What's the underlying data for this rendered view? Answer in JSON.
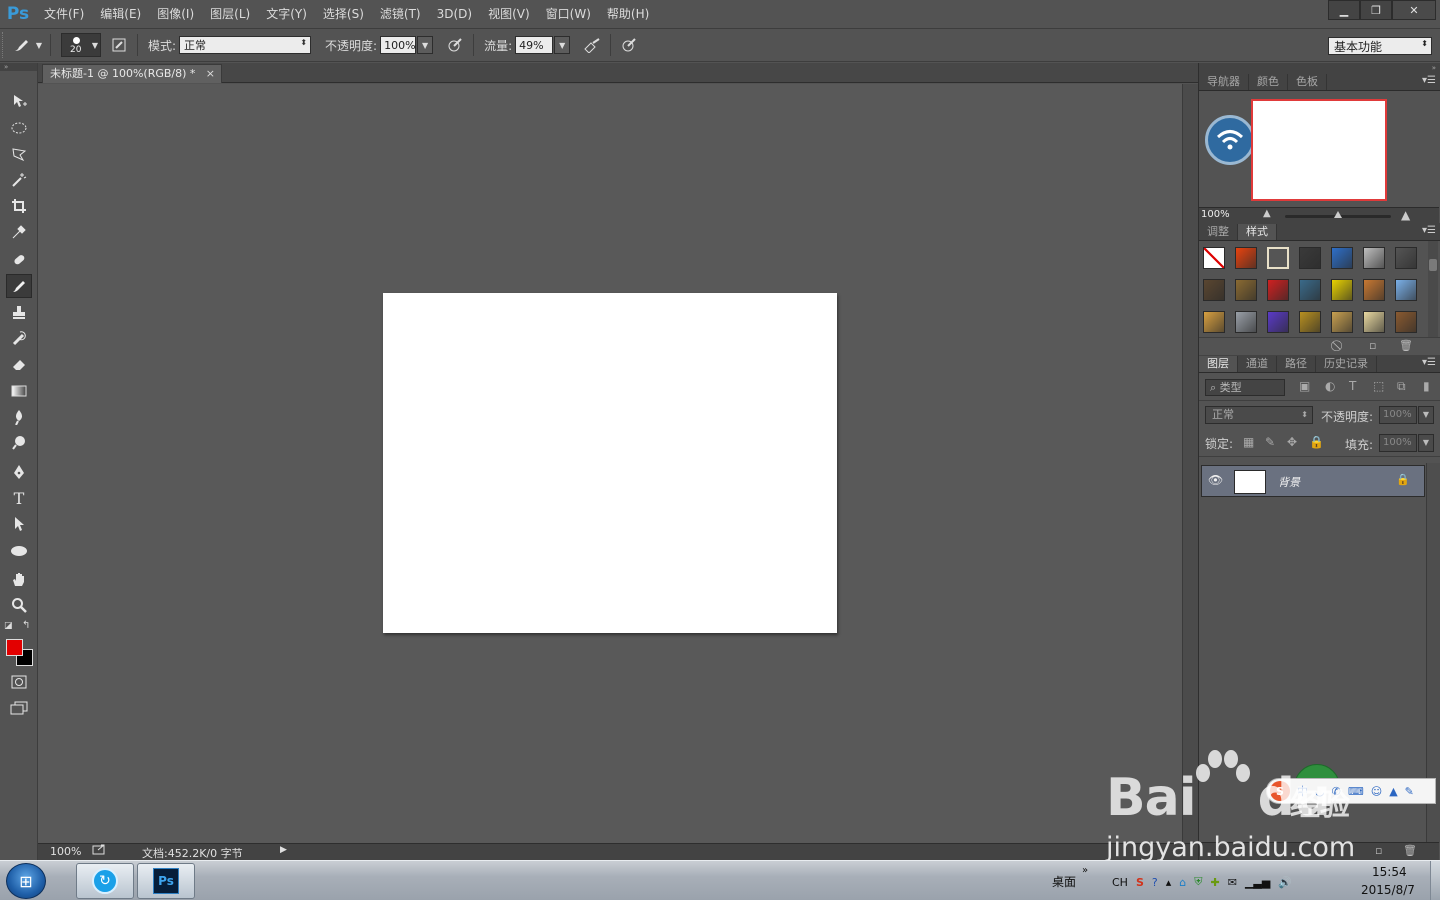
{
  "app": {
    "logo": "Ps",
    "menu": [
      "文件(F)",
      "编辑(E)",
      "图像(I)",
      "图层(L)",
      "文字(Y)",
      "选择(S)",
      "滤镜(T)",
      "3D(D)",
      "视图(V)",
      "窗口(W)",
      "帮助(H)"
    ],
    "window_controls": {
      "minimize": "▁",
      "restore": "❐",
      "close": "✕"
    }
  },
  "options": {
    "brush_size": "20",
    "mode_label": "模式:",
    "mode_value": "正常",
    "opacity_label": "不透明度:",
    "opacity_value": "100%",
    "flow_label": "流量:",
    "flow_value": "49%",
    "workspace": "基本功能"
  },
  "document": {
    "tab_title": "未标题-1 @ 100%(RGB/8) *",
    "tab_close": "×",
    "status_zoom": "100%",
    "status_info": "文档:452.2K/0 字节"
  },
  "panels": {
    "nav_tabs": [
      "导航器",
      "颜色",
      "色板"
    ],
    "nav_active": 0,
    "nav_zoom": "100%",
    "style_tabs": [
      "调整",
      "样式"
    ],
    "style_active": 1,
    "style_swatches": [
      "#e8e8e8",
      "#e8430f",
      "#d8d2c0",
      "#3a3a3a",
      "#2e6fc9",
      "#bfbfbf",
      "#555555",
      "#5a4630",
      "#8a6a32",
      "#d02020",
      "#3a6a8a",
      "#e8d200",
      "#c87832",
      "#7ab0e8",
      "#d8a040",
      "#9aa0a8",
      "#5a3ac8",
      "#b89020",
      "#c8a050",
      "#e8d8a0",
      "#8a5a30"
    ],
    "layers_tabs": [
      "图层",
      "通道",
      "路径",
      "历史记录"
    ],
    "layers_active": 0,
    "layers_filter": "类型",
    "blend_mode": "正常",
    "opacity_label": "不透明度:",
    "opacity_value": "100%",
    "lock_label": "锁定:",
    "fill_label": "填充:",
    "fill_value": "100%",
    "layer_name": "背景"
  },
  "colors": {
    "foreground": "#e30000",
    "background": "#000000"
  },
  "ime": {
    "logo": "S",
    "mode": "中"
  },
  "watermark": {
    "brand": "Bai",
    "brand2": "du",
    "cn": "经验",
    "url": "jingyan.baidu.com"
  },
  "taskbar": {
    "desktop_label": "桌面",
    "tray_lang": "CH",
    "time": "15:54",
    "date": "2015/8/7",
    "ps_label": "Ps"
  }
}
